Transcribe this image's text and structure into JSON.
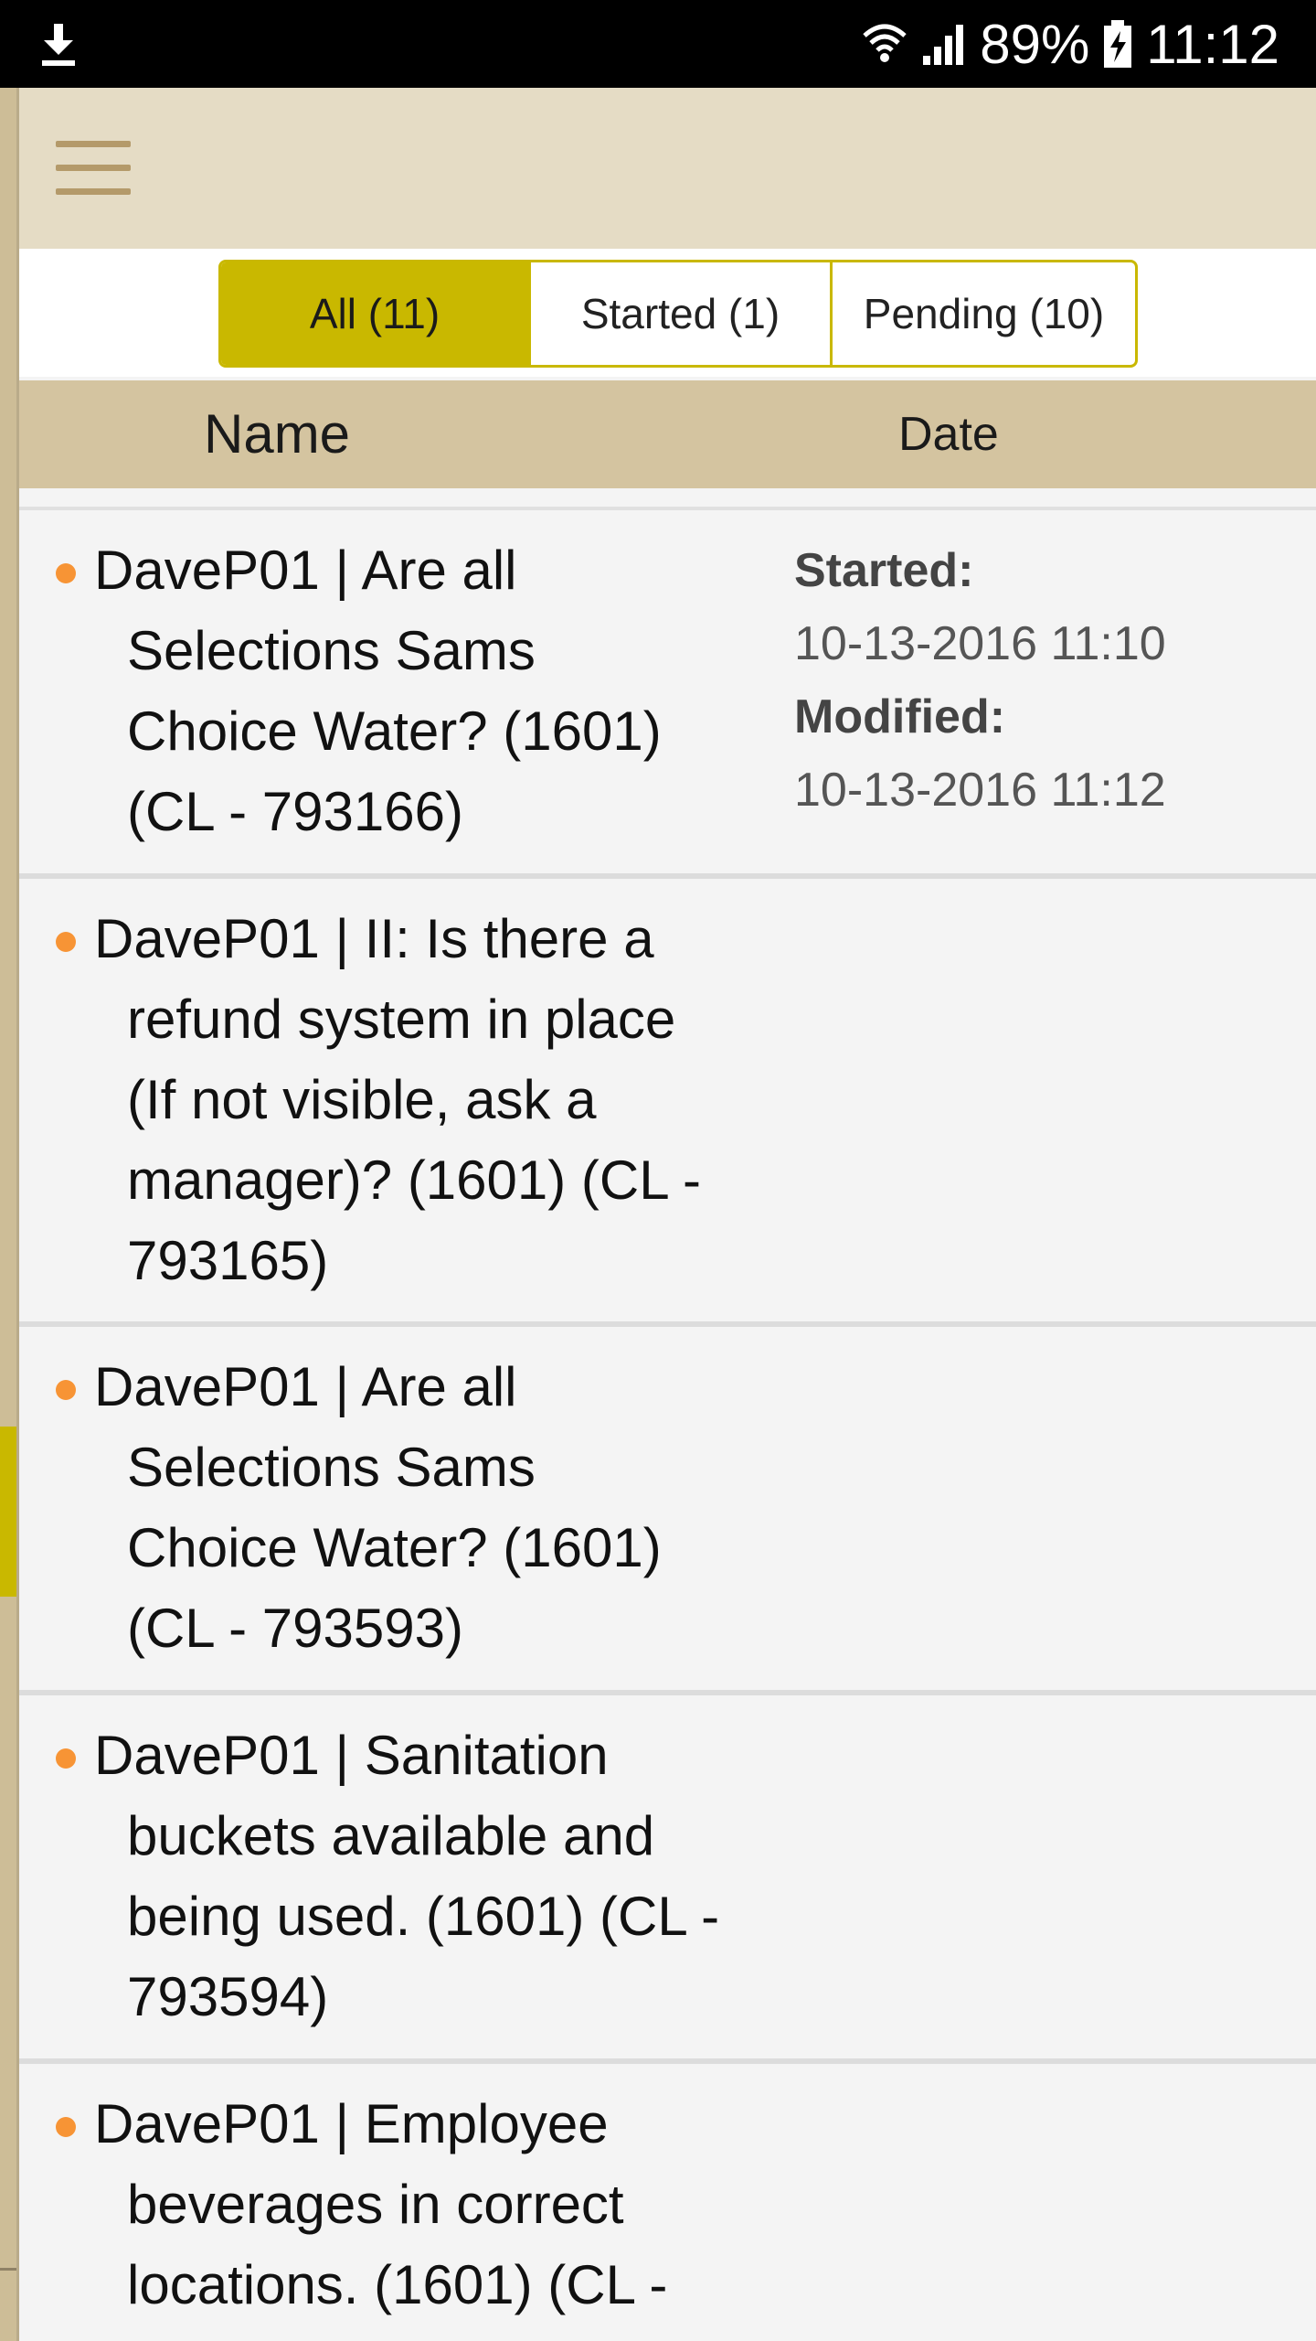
{
  "status_bar": {
    "battery": "89%",
    "time": "11:12",
    "icons": [
      "download-icon",
      "wifi-icon",
      "signal-icon",
      "battery-charging-icon"
    ]
  },
  "app_bar": {
    "menu_icon": "hamburger-menu-icon"
  },
  "filters": {
    "all": "All (11)",
    "started": "Started (1)",
    "pending": "Pending (10)",
    "selected": "all"
  },
  "table": {
    "header_name": "Name",
    "header_date": "Date"
  },
  "rows": [
    {
      "first_line": "DaveP01 | Are all",
      "rest_lines": [
        "Selections Sams",
        "Choice Water? (1601)",
        "(CL - 793166)"
      ],
      "started_label": "Started:",
      "started": "10-13-2016 11:10",
      "modified_label": "Modified:",
      "modified": "10-13-2016 11:12"
    },
    {
      "first_line": "DaveP01 | II: Is there a",
      "rest_lines": [
        "refund system in place",
        "(If not visible, ask a",
        "manager)? (1601) (CL -",
        "793165)"
      ]
    },
    {
      "first_line": "DaveP01 | Are all",
      "rest_lines": [
        "Selections Sams",
        "Choice Water? (1601)",
        "(CL - 793593)"
      ]
    },
    {
      "first_line": "DaveP01 | Sanitation",
      "rest_lines": [
        "buckets available and",
        "being used. (1601) (CL -",
        "793594)"
      ]
    },
    {
      "first_line": "DaveP01 | Employee",
      "rest_lines": [
        "beverages in correct",
        "locations. (1601) (CL -"
      ]
    }
  ],
  "colors": {
    "accent": "#c9b800",
    "app_bar": "#e5dcc5",
    "header": "#d4c4a0",
    "bullet": "#f79435"
  }
}
